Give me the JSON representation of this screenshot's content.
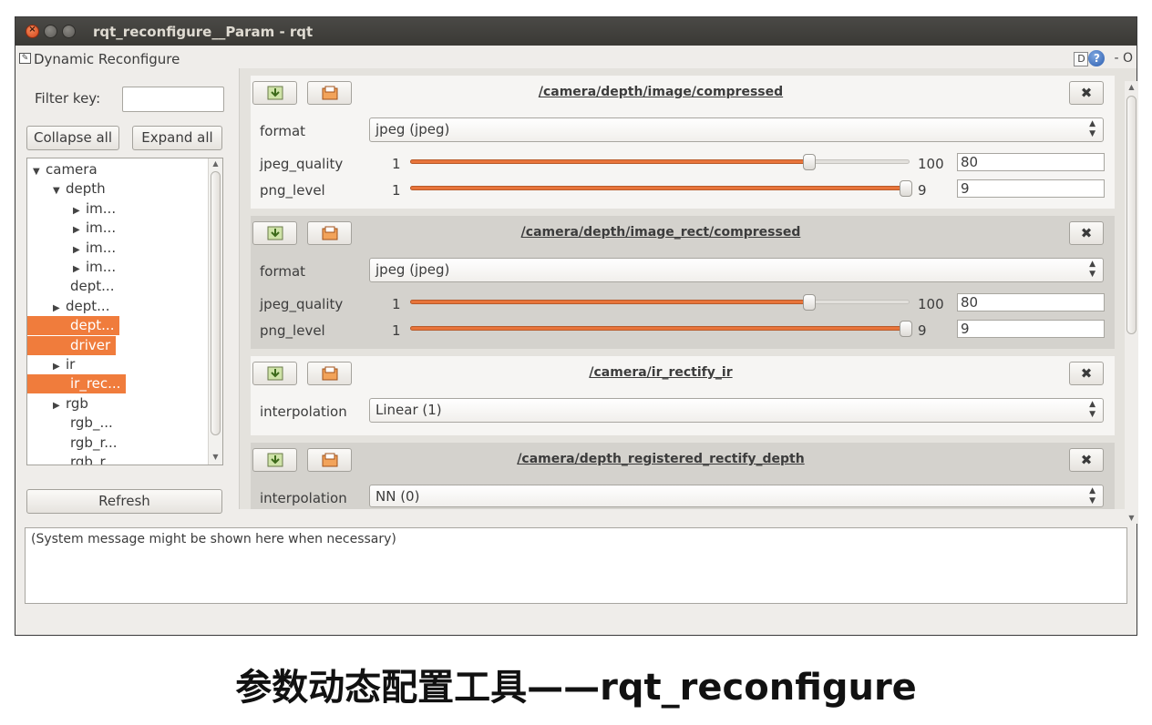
{
  "window": {
    "title": "rqt_reconfigure__Param - rqt",
    "controls": {
      "close": "×",
      "minimize": "−",
      "maximize": "□"
    }
  },
  "plugin": {
    "title": "Dynamic Reconfigure",
    "d_label": "D",
    "help_label": "?",
    "right_controls": "- O"
  },
  "left": {
    "filter_label": "Filter key:",
    "filter_value": "",
    "collapse_label": "Collapse all",
    "expand_label": "Expand all",
    "refresh_label": "Refresh",
    "tree": [
      {
        "label": "camera",
        "arrow": "▼",
        "selected": false
      },
      {
        "label": "depth",
        "arrow": "▼",
        "selected": false
      },
      {
        "label": "im...",
        "arrow": "▶",
        "selected": false
      },
      {
        "label": "im...",
        "arrow": "▶",
        "selected": false
      },
      {
        "label": "im...",
        "arrow": "▶",
        "selected": false
      },
      {
        "label": "im...",
        "arrow": "▶",
        "selected": false
      },
      {
        "label": "dept...",
        "arrow": "",
        "selected": false
      },
      {
        "label": "dept...",
        "arrow": "▶",
        "selected": false
      },
      {
        "label": "dept...",
        "arrow": "",
        "selected": true
      },
      {
        "label": "driver",
        "arrow": "",
        "selected": true
      },
      {
        "label": "ir",
        "arrow": "▶",
        "selected": false
      },
      {
        "label": "ir_rec...",
        "arrow": "",
        "selected": true
      },
      {
        "label": "rgb",
        "arrow": "▶",
        "selected": false
      },
      {
        "label": "rgb_...",
        "arrow": "",
        "selected": false
      },
      {
        "label": "rgb_r...",
        "arrow": "",
        "selected": false
      },
      {
        "label": "rgb_r...",
        "arrow": "",
        "selected": false
      }
    ]
  },
  "panels": [
    {
      "title": "/camera/depth/image/compressed",
      "close": "✖",
      "params": {
        "format": {
          "label": "format",
          "value": "jpeg (jpeg)"
        },
        "jpeg_quality": {
          "label": "jpeg_quality",
          "min": "1",
          "max": "100",
          "value": "80",
          "fraction": 0.8
        },
        "png_level": {
          "label": "png_level",
          "min": "1",
          "max": "9",
          "value": "9",
          "fraction": 1.0
        }
      }
    },
    {
      "title": "/camera/depth/image_rect/compressed",
      "close": "✖",
      "params": {
        "format": {
          "label": "format",
          "value": "jpeg (jpeg)"
        },
        "jpeg_quality": {
          "label": "jpeg_quality",
          "min": "1",
          "max": "100",
          "value": "80",
          "fraction": 0.8
        },
        "png_level": {
          "label": "png_level",
          "min": "1",
          "max": "9",
          "value": "9",
          "fraction": 1.0
        }
      }
    },
    {
      "title": "/camera/ir_rectify_ir",
      "close": "✖",
      "params": {
        "interpolation": {
          "label": "interpolation",
          "value": "Linear (1)"
        }
      }
    },
    {
      "title": "/camera/depth_registered_rectify_depth",
      "close": "✖",
      "params": {
        "interpolation": {
          "label": "interpolation",
          "value": "NN (0)"
        }
      }
    }
  ],
  "message": "(System message might be shown here when necessary)",
  "caption": "参数动态配置工具——rqt_reconfigure",
  "colors": {
    "accent": "#f07c3c",
    "slider_fill": "#e8743a"
  }
}
